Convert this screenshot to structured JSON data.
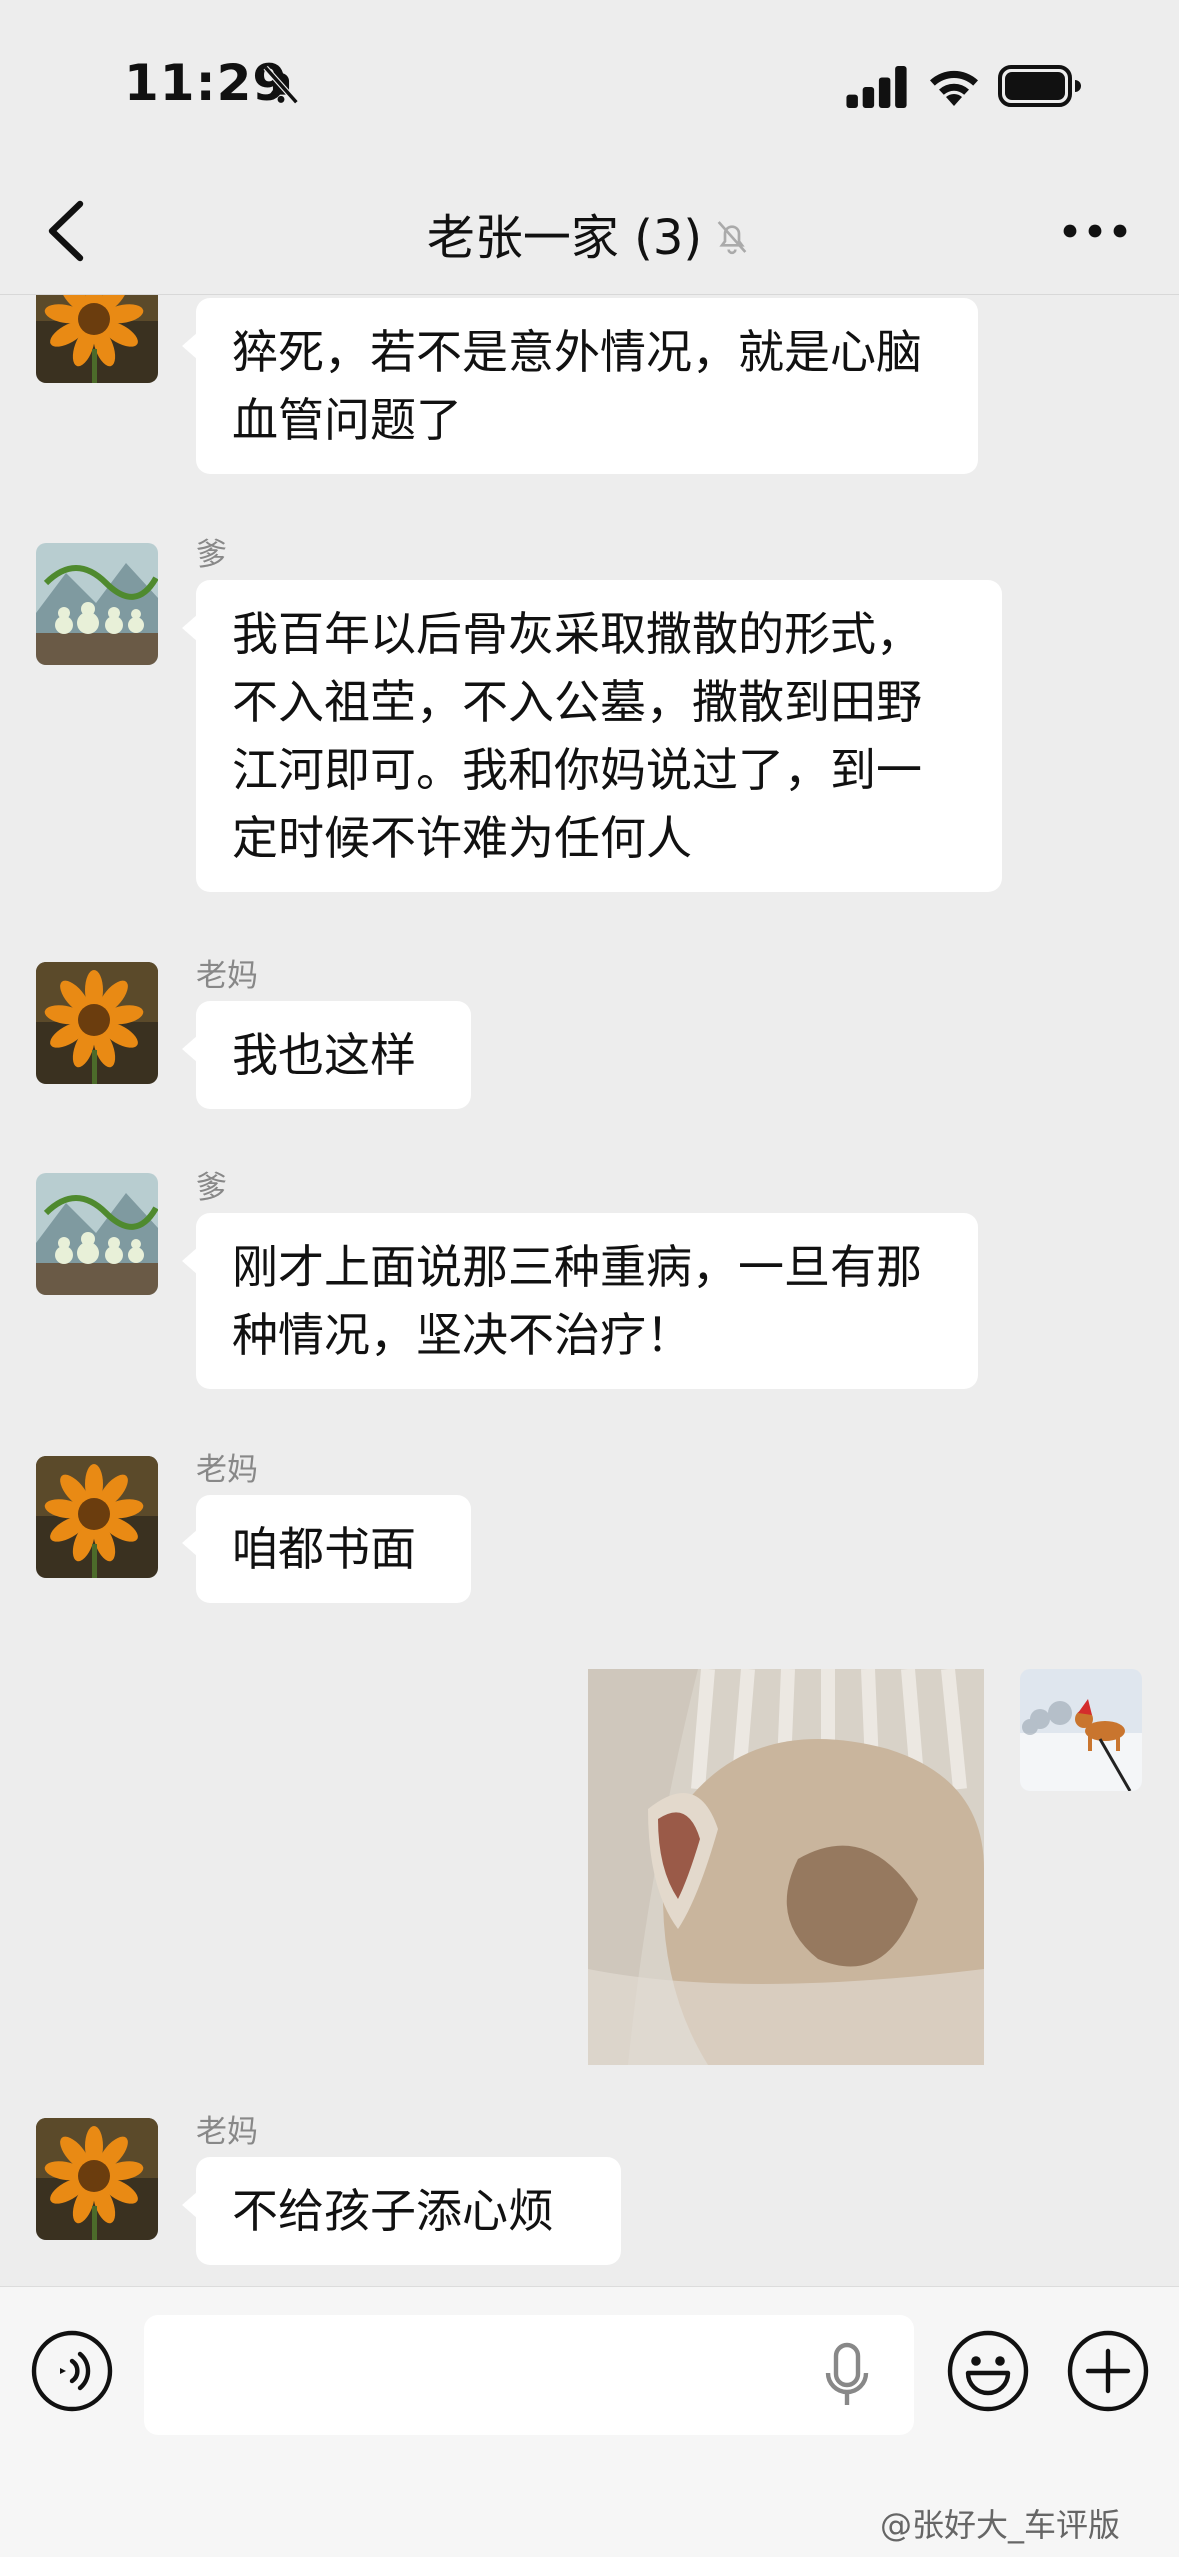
{
  "status": {
    "time": "11:29"
  },
  "header": {
    "title": "老张一家 (3)"
  },
  "messages": [
    {
      "text": "猝死，若不是意外情况，就是心脑血管问题了"
    },
    {
      "sender": "爹",
      "text": "我百年以后骨灰采取撒散的形式，不入祖茔，不入公墓，撒散到田野江河即可。我和你妈说过了，到一定时候不许难为任何人"
    },
    {
      "sender": "老妈",
      "text": "我也这样"
    },
    {
      "sender": "爹",
      "text": "刚才上面说那三种重病，一旦有那种情况，坚决不治疗！"
    },
    {
      "sender": "老妈",
      "text": "咱都书面"
    },
    {
      "sender": "老妈",
      "text": "不给孩子添心烦"
    }
  ],
  "watermark": "@张好大_车评版",
  "colors": {
    "background": "#ededed",
    "bubble": "#ffffff",
    "sender": "#888888"
  },
  "icons": [
    "back-icon",
    "mute-bell-icon",
    "more-icon",
    "voice-icon",
    "mic-icon",
    "emoji-icon",
    "plus-icon"
  ]
}
